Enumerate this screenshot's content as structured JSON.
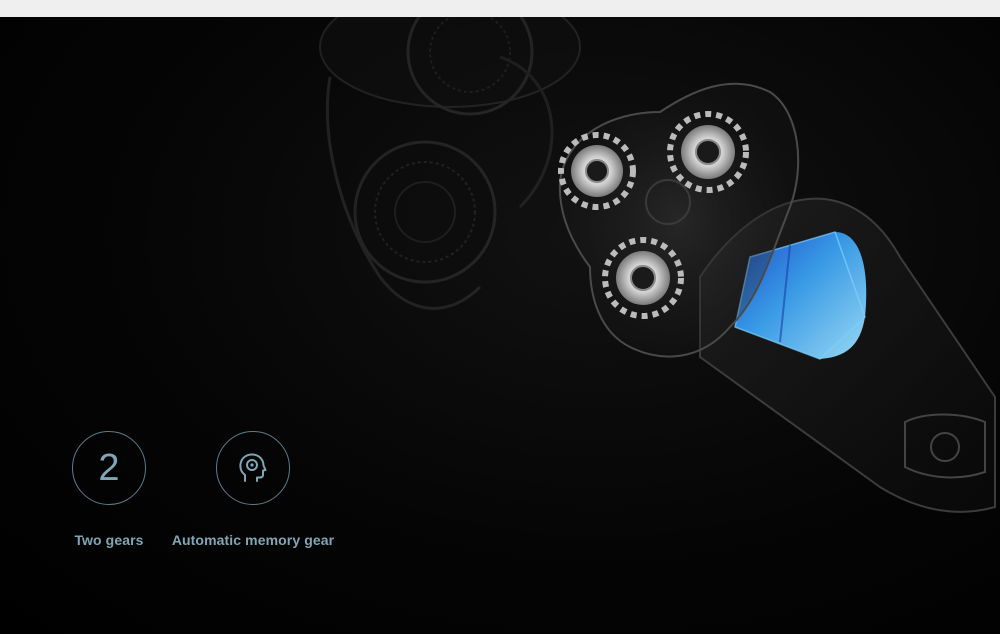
{
  "features": [
    {
      "icon": "number-2-icon",
      "value": "2",
      "label": "Two gears"
    },
    {
      "icon": "head-memory-icon",
      "label": "Automatic memory gear"
    }
  ],
  "colors": {
    "background": "#000000",
    "accent": "#7fa6b6",
    "circle_outline": "#5c7d8a",
    "battery_blue": "#3aa0f0"
  }
}
